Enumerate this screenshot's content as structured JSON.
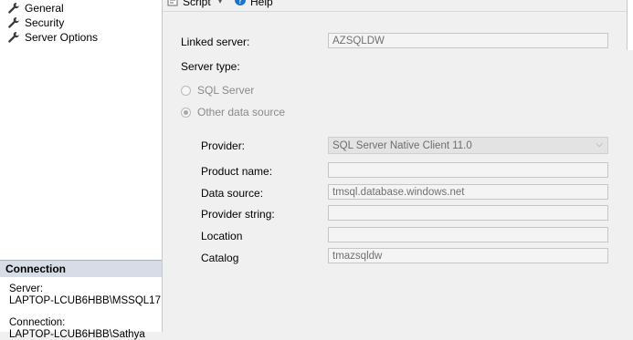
{
  "sidebar": {
    "pages": [
      {
        "label": "General",
        "icon": "wrench-icon"
      },
      {
        "label": "Security",
        "icon": "wrench-icon"
      },
      {
        "label": "Server Options",
        "icon": "wrench-icon"
      }
    ],
    "connection": {
      "header": "Connection",
      "server_label": "Server:",
      "server_value": "LAPTOP-LCUB6HBB\\MSSQL17",
      "connection_label": "Connection:",
      "connection_value": "LAPTOP-LCUB6HBB\\Sathya"
    }
  },
  "toolbar": {
    "script_label": "Script",
    "help_label": "Help"
  },
  "form": {
    "linked_server_label": "Linked server:",
    "linked_server_value": "AZSQLDW",
    "server_type_label": "Server type:",
    "radio_sql_server": "SQL Server",
    "radio_other": "Other data source",
    "selected_server_type": "Other data source",
    "provider_label": "Provider:",
    "provider_value": "SQL Server Native Client 11.0",
    "product_name_label": "Product name:",
    "product_name_value": "",
    "data_source_label": "Data source:",
    "data_source_value": "tmsql.database.windows.net",
    "provider_string_label": "Provider string:",
    "provider_string_value": "",
    "location_label": "Location",
    "location_value": "",
    "catalog_label": "Catalog",
    "catalog_value": "tmazsqldw"
  },
  "colors": {
    "connection_header_bg": "#d7dde6",
    "help_icon": "#1e73c8"
  }
}
